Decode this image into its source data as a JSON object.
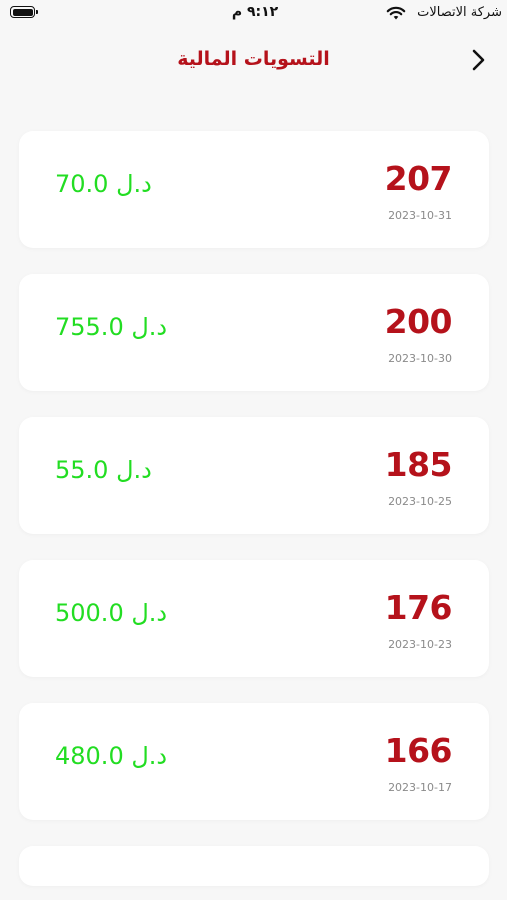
{
  "status_bar": {
    "carrier": "شركة الاتصالات",
    "time": "٩:١٢ م"
  },
  "header": {
    "title": "التسويات المالية"
  },
  "settlements": [
    {
      "number": "207",
      "date": "2023-10-31",
      "amount": "70.0 د.ل"
    },
    {
      "number": "200",
      "date": "2023-10-30",
      "amount": "755.0 د.ل"
    },
    {
      "number": "185",
      "date": "2023-10-25",
      "amount": "55.0 د.ل"
    },
    {
      "number": "176",
      "date": "2023-10-23",
      "amount": "500.0 د.ل"
    },
    {
      "number": "166",
      "date": "2023-10-17",
      "amount": "480.0 د.ل"
    }
  ],
  "colors": {
    "accent_red": "#b5121b",
    "amount_green": "#22dd22",
    "background": "#f7f7f7"
  },
  "icons": {
    "back": "chevron-right-icon",
    "wifi": "wifi-icon",
    "battery": "battery-icon"
  }
}
